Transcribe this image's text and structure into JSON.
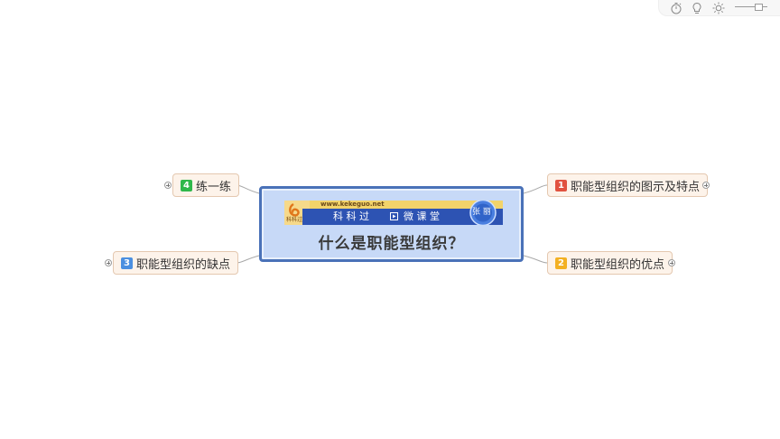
{
  "central_topic": {
    "title": "什么是职能型组织？",
    "banner": {
      "logo_text": "科科过",
      "url": "www.kekeguo.net",
      "brand": "科 科 过",
      "section": "微 课 堂",
      "badge": "张 丽"
    }
  },
  "topics": [
    {
      "marker": "1",
      "label": "职能型组织的图示及特点",
      "marker_color": "#e15240"
    },
    {
      "marker": "2",
      "label": "职能型组织的优点",
      "marker_color": "#f3b022"
    },
    {
      "marker": "3",
      "label": "职能型组织的缺点",
      "marker_color": "#4b8fe0"
    },
    {
      "marker": "4",
      "label": "练一练",
      "marker_color": "#2fb84b"
    }
  ],
  "toolbar": {
    "icons": [
      "timer-icon",
      "lightbulb-icon",
      "brightness-icon",
      "zoom-slider"
    ]
  },
  "colors": {
    "central_fill": "#c7d9f7",
    "central_border": "#4a72b8",
    "topic_fill": "#fdf3ea",
    "topic_border": "#e4c8b0",
    "banner_blue": "#2d53b3"
  }
}
